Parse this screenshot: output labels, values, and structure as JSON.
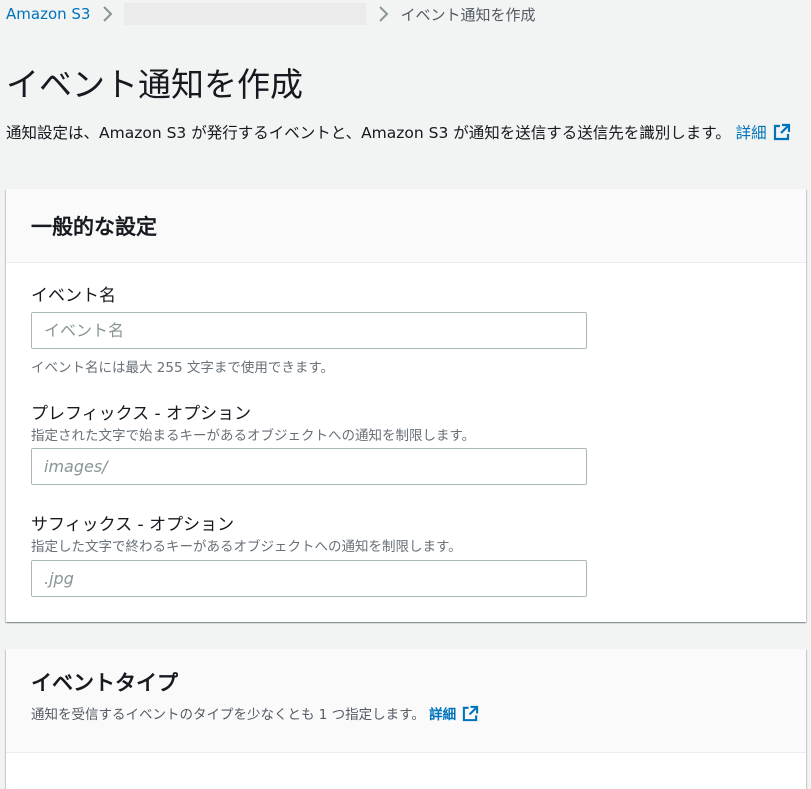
{
  "breadcrumb": {
    "root": "Amazon S3",
    "current": "イベント通知を作成"
  },
  "page": {
    "title": "イベント通知を作成",
    "description": "通知設定は、Amazon S3 が発行するイベントと、Amazon S3 が通知を送信する送信先を識別します。",
    "details_link": "詳細"
  },
  "general": {
    "title": "一般的な設定",
    "event_name": {
      "label": "イベント名",
      "placeholder": "イベント名",
      "hint": "イベント名には最大 255 文字まで使用できます。"
    },
    "prefix": {
      "label": "プレフィックス - オプション",
      "description": "指定された文字で始まるキーがあるオブジェクトへの通知を制限します。",
      "placeholder": "images/"
    },
    "suffix": {
      "label": "サフィックス - オプション",
      "description": "指定した文字で終わるキーがあるオブジェクトへの通知を制限します。",
      "placeholder": ".jpg"
    }
  },
  "event_types": {
    "title": "イベントタイプ",
    "description": "通知を受信するイベントのタイプを少なくとも 1 つ指定します。",
    "details_link": "詳細"
  },
  "colors": {
    "link": "#0073bb",
    "background": "#f2f3f3",
    "text": "#16191f",
    "muted": "#687078"
  },
  "icons": [
    "chevron-right-icon",
    "external-link-icon"
  ]
}
